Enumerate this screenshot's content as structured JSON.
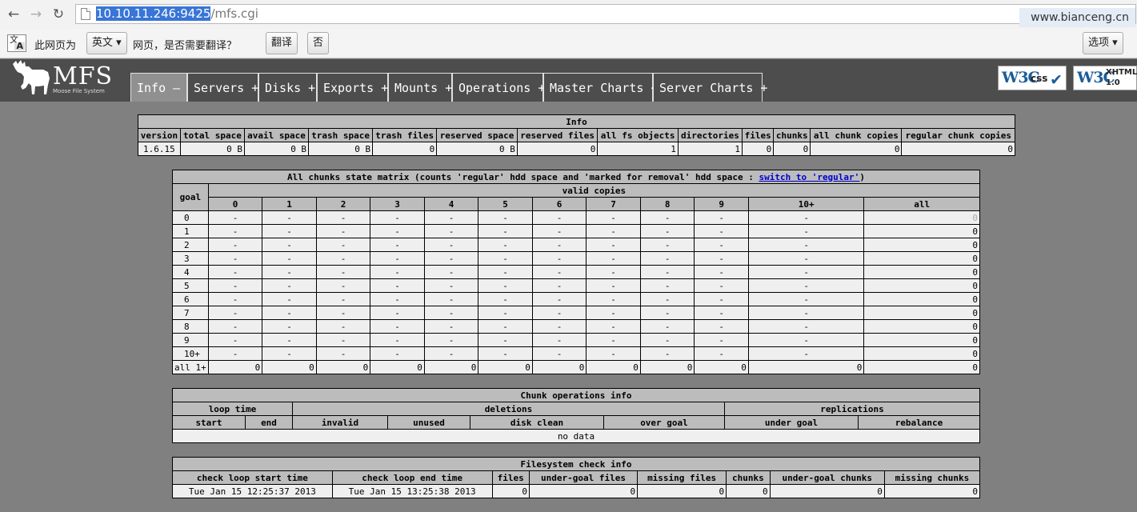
{
  "browser": {
    "url_host": "10.10.11.246:9425",
    "url_path": "/mfs.cgi",
    "watermark": "www.bianceng.cn"
  },
  "translate_bar": {
    "icon_glyph": "文",
    "icon_letter": "A",
    "prefix": "此网页为",
    "language": "英文",
    "question": "网页，是否需要翻译？",
    "translate_label": "翻译",
    "no_label": "否",
    "options_label": "选项"
  },
  "header": {
    "logo_text": "MFS",
    "logo_sub": "Moose File System",
    "tabs": [
      {
        "label": "Info –"
      },
      {
        "label": "Servers +"
      },
      {
        "label": "Disks +"
      },
      {
        "label": "Exports +"
      },
      {
        "label": "Mounts +"
      },
      {
        "label": "Operations +"
      },
      {
        "label": "Master Charts +"
      },
      {
        "label": "Server Charts +"
      }
    ],
    "badges": [
      {
        "logo": "W3C",
        "type": "css"
      },
      {
        "logo": "W3C",
        "type": "XHTML",
        "version": "1.0"
      }
    ],
    "colors": {
      "header_bg": "#4d4d4d",
      "active_tab": "#909090",
      "page_bg": "#808080",
      "table_header": "#bcbcbc",
      "table_cell": "#efefef"
    }
  },
  "info": {
    "title": "Info",
    "headers": [
      "version",
      "total space",
      "avail space",
      "trash space",
      "trash files",
      "reserved space",
      "reserved files",
      "all fs objects",
      "directories",
      "files",
      "chunks",
      "all chunk copies",
      "regular chunk copies"
    ],
    "values": [
      "1.6.15",
      "0 B",
      "0 B",
      "0 B",
      "0",
      "0 B",
      "0",
      "1",
      "1",
      "0",
      "0",
      "0",
      "0"
    ]
  },
  "matrix": {
    "title_prefix": "All chunks state matrix (counts 'regular' hdd space and 'marked for removal' hdd space : ",
    "title_link": "switch to 'regular'",
    "title_suffix": ")",
    "goal_label": "goal",
    "valid_label": "valid copies",
    "columns": [
      "0",
      "1",
      "2",
      "3",
      "4",
      "5",
      "6",
      "7",
      "8",
      "9",
      "10+",
      "all"
    ],
    "rows": [
      {
        "goal": "0",
        "cells": [
          "-",
          "-",
          "-",
          "-",
          "-",
          "-",
          "-",
          "-",
          "-",
          "-",
          "-",
          "0"
        ]
      },
      {
        "goal": "1",
        "cells": [
          "-",
          "-",
          "-",
          "-",
          "-",
          "-",
          "-",
          "-",
          "-",
          "-",
          "-",
          "0"
        ]
      },
      {
        "goal": "2",
        "cells": [
          "-",
          "-",
          "-",
          "-",
          "-",
          "-",
          "-",
          "-",
          "-",
          "-",
          "-",
          "0"
        ]
      },
      {
        "goal": "3",
        "cells": [
          "-",
          "-",
          "-",
          "-",
          "-",
          "-",
          "-",
          "-",
          "-",
          "-",
          "-",
          "0"
        ]
      },
      {
        "goal": "4",
        "cells": [
          "-",
          "-",
          "-",
          "-",
          "-",
          "-",
          "-",
          "-",
          "-",
          "-",
          "-",
          "0"
        ]
      },
      {
        "goal": "5",
        "cells": [
          "-",
          "-",
          "-",
          "-",
          "-",
          "-",
          "-",
          "-",
          "-",
          "-",
          "-",
          "0"
        ]
      },
      {
        "goal": "6",
        "cells": [
          "-",
          "-",
          "-",
          "-",
          "-",
          "-",
          "-",
          "-",
          "-",
          "-",
          "-",
          "0"
        ]
      },
      {
        "goal": "7",
        "cells": [
          "-",
          "-",
          "-",
          "-",
          "-",
          "-",
          "-",
          "-",
          "-",
          "-",
          "-",
          "0"
        ]
      },
      {
        "goal": "8",
        "cells": [
          "-",
          "-",
          "-",
          "-",
          "-",
          "-",
          "-",
          "-",
          "-",
          "-",
          "-",
          "0"
        ]
      },
      {
        "goal": "9",
        "cells": [
          "-",
          "-",
          "-",
          "-",
          "-",
          "-",
          "-",
          "-",
          "-",
          "-",
          "-",
          "0"
        ]
      },
      {
        "goal": "10+",
        "cells": [
          "-",
          "-",
          "-",
          "-",
          "-",
          "-",
          "-",
          "-",
          "-",
          "-",
          "-",
          "0"
        ]
      }
    ],
    "total_row": {
      "goal": "all 1+",
      "cells": [
        "0",
        "0",
        "0",
        "0",
        "0",
        "0",
        "0",
        "0",
        "0",
        "0",
        "0",
        "0"
      ]
    }
  },
  "chunk_ops": {
    "title": "Chunk operations info",
    "loop_time": "loop time",
    "deletions": "deletions",
    "replications": "replications",
    "columns": [
      "start",
      "end",
      "invalid",
      "unused",
      "disk clean",
      "over goal",
      "under goal",
      "rebalance"
    ],
    "no_data": "no data"
  },
  "fs_check": {
    "title": "Filesystem check info",
    "headers": [
      "check loop start time",
      "check loop end time",
      "files",
      "under-goal files",
      "missing files",
      "chunks",
      "under-goal chunks",
      "missing chunks"
    ],
    "values": [
      "Tue Jan 15 12:25:37 2013",
      "Tue Jan 15 13:25:38 2013",
      "0",
      "0",
      "0",
      "0",
      "0",
      "0"
    ]
  }
}
